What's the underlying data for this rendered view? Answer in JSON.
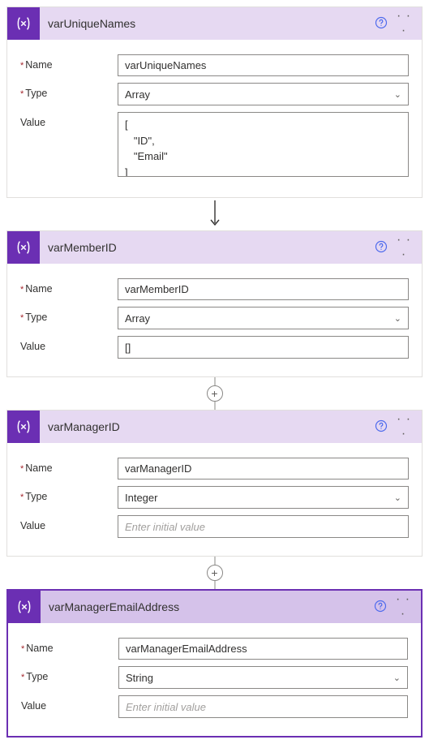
{
  "labels": {
    "name": "Name",
    "type": "Type",
    "value": "Value"
  },
  "placeholders": {
    "initial": "Enter initial value"
  },
  "connectors": {
    "plus": "+"
  },
  "cards": [
    {
      "title": "varUniqueNames",
      "name_value": "varUniqueNames",
      "type_value": "Array",
      "value_text": "[\n   \"ID\",\n   \"Email\"\n]",
      "value_multiline": true,
      "selected": false,
      "show_add": false
    },
    {
      "title": "varMemberID",
      "name_value": "varMemberID",
      "type_value": "Array",
      "value_text": "[]",
      "value_multiline": false,
      "selected": false,
      "show_add": true
    },
    {
      "title": "varManagerID",
      "name_value": "varManagerID",
      "type_value": "Integer",
      "value_text": "",
      "value_multiline": false,
      "selected": false,
      "show_add": true
    },
    {
      "title": "varManagerEmailAddress",
      "name_value": "varManagerEmailAddress",
      "type_value": "String",
      "value_text": "",
      "value_multiline": false,
      "selected": true,
      "show_add": false
    }
  ]
}
